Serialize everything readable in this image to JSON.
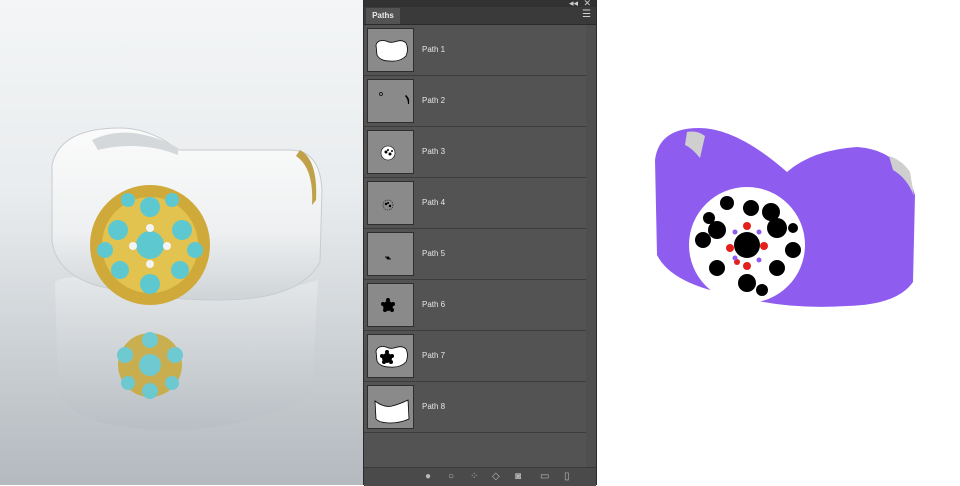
{
  "panel": {
    "tab_label": "Paths",
    "menu_icon": "panel-menu-icon",
    "collapse_icon": "double-chevron-icon",
    "close_icon": "close-icon",
    "paths": [
      {
        "label": "Path 1"
      },
      {
        "label": "Path 2"
      },
      {
        "label": "Path 3"
      },
      {
        "label": "Path 4"
      },
      {
        "label": "Path 5"
      },
      {
        "label": "Path 6"
      },
      {
        "label": "Path 7"
      },
      {
        "label": "Path 8"
      }
    ],
    "bottom_tools": [
      "fill-path-icon",
      "stroke-path-icon",
      "load-selection-icon",
      "make-work-path-icon",
      "add-mask-icon",
      "new-path-icon",
      "trash-icon"
    ]
  },
  "colors": {
    "panel_bg": "#535353",
    "mask_purple": "#8f5cf0",
    "gem_red": "#e3201b"
  }
}
